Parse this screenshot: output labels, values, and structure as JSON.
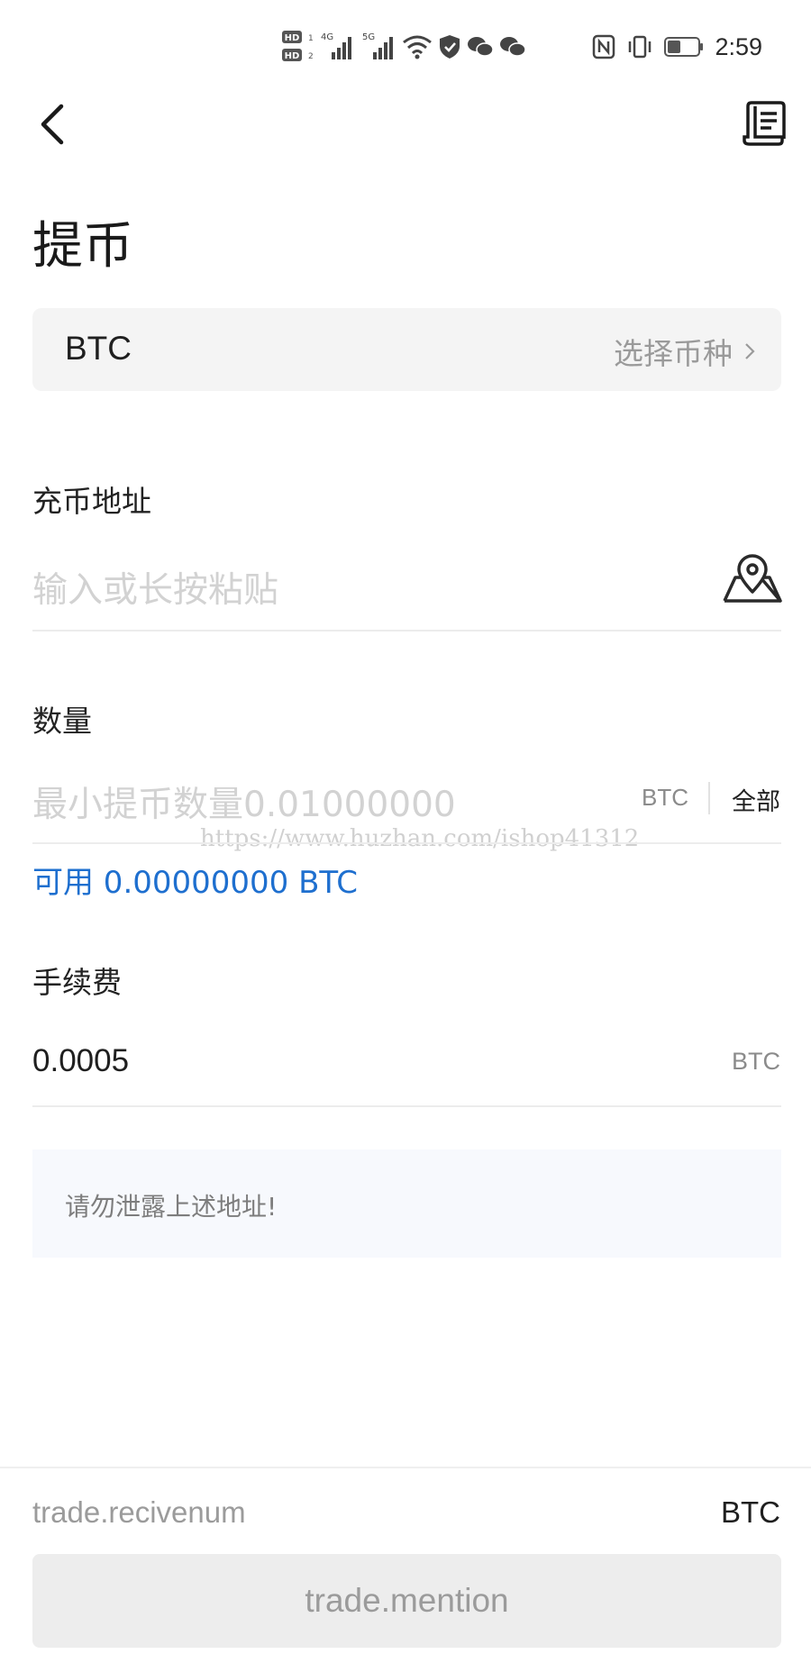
{
  "status_bar": {
    "time": "2:59",
    "hd_1": "HD",
    "hd_2": "HD",
    "net_1": "4G",
    "net_2": "5G"
  },
  "header": {
    "back_icon": "chevron-left-icon",
    "record_icon": "receipt-icon"
  },
  "title": "提币",
  "coin": {
    "name": "BTC",
    "select_label": "选择币种"
  },
  "address": {
    "label": "充币地址",
    "placeholder": "输入或长按粘贴",
    "icon": "location-map-icon"
  },
  "amount": {
    "label": "数量",
    "placeholder": "最小提币数量0.01000000",
    "unit": "BTC",
    "all_label": "全部"
  },
  "watermark": "https://www.huzhan.com/ishop41312",
  "available": "可用 0.00000000 BTC",
  "fee": {
    "label": "手续费",
    "value": "0.0005",
    "unit": "BTC"
  },
  "notice": "请勿泄露上述地址!",
  "footer": {
    "receive_label": "trade.recivenum",
    "receive_unit": "BTC",
    "submit_label": "trade.mention"
  },
  "colors": {
    "accent_blue": "#1e6fcf",
    "card_bg": "#f4f4f4",
    "notice_bg": "#f7f9fd",
    "button_bg": "#ededed"
  }
}
